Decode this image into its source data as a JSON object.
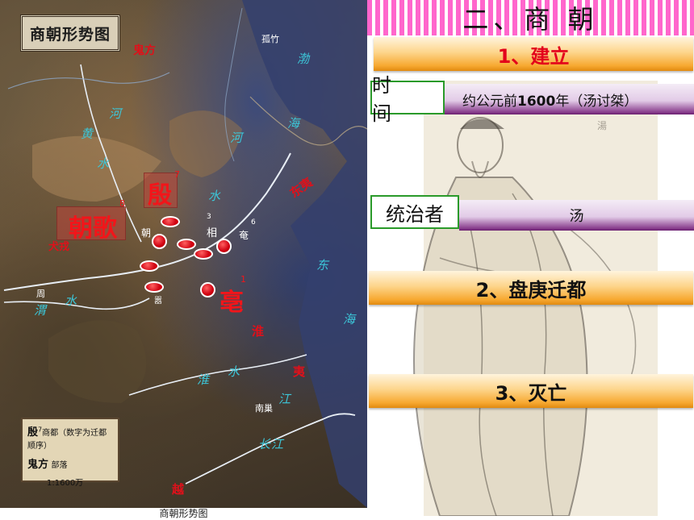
{
  "map": {
    "title": "商朝形势图",
    "caption": "商朝形势图",
    "labels": {
      "guifang": "鬼方",
      "chaoge": "朝歌",
      "chaoge_num": "8",
      "yin": "殷",
      "yin_num": "7",
      "bo": "亳",
      "bo_num": "1",
      "quanrong": "犬戎",
      "dongyi": "东夷",
      "huai": "淮",
      "yi": "夷",
      "zhou": "周",
      "xiang": "相",
      "xiang_num": "3",
      "yan": "奄",
      "yan_num": "6",
      "ao": "嚣",
      "chao_small": "朝",
      "xing": "邢",
      "nanchao": "南巢",
      "gutz": "孤竹",
      "bohai": "渤",
      "hai1": "海",
      "dong": "东",
      "hai2": "海",
      "he1": "河",
      "he2": "河",
      "huang": "黄",
      "shui1": "水",
      "shui2": "水",
      "wei": "渭",
      "shui3": "水",
      "huai_river": "淮",
      "shui4": "水",
      "changjiang1": "长",
      "changjiang2": "江",
      "jiang": "江",
      "yue": "越"
    },
    "legend": {
      "line1_main": "殷",
      "line1_sup": "7",
      "line1_rest": "商都（数字为迁都顺序）",
      "line2_main": "鬼方",
      "line2_rest": "部落",
      "line3": "1:1600万"
    }
  },
  "slide": {
    "heading": "二、商 朝",
    "section1": "1、建立",
    "time_label": "时 间",
    "time_value_prefix": "约公元前",
    "time_value_bold": "1600",
    "time_value_suffix": "年（汤讨桀）",
    "ruler_label": "统治者",
    "ruler_value": "汤",
    "section2": "2、盘庚迁都",
    "section3": "3、灭亡"
  },
  "colors": {
    "accent_orange": "#f7a830",
    "heading_pink": "#ff66cc",
    "purple": "#8a3f8e",
    "tag_border": "#2a9a2a",
    "capital_red": "#e0101a"
  }
}
